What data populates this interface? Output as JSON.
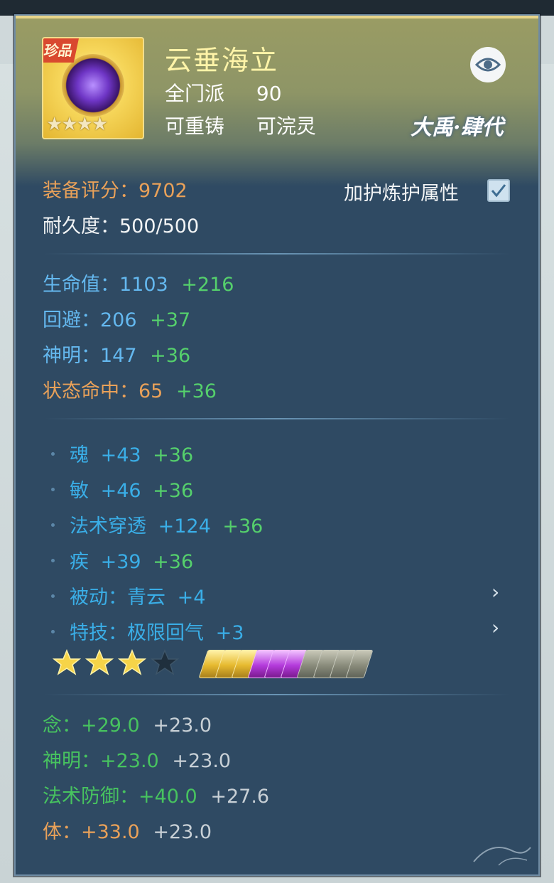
{
  "item": {
    "name": "云垂海立",
    "rarity_tag": "珍品",
    "icon_stars": "★★★★",
    "sect": "全门派",
    "level": "90",
    "reforgeable": "可重铸",
    "washable": "可浣灵",
    "brand": "大禹·肆代"
  },
  "score": {
    "label": "装备评分：",
    "value": "9702"
  },
  "durability": {
    "label": "耐久度：",
    "value": "500/500"
  },
  "protect_toggle": {
    "label": "加护炼护属性",
    "checked": true
  },
  "base_stats": [
    {
      "label": "生命值：",
      "value": "1103",
      "bonus": "+216"
    },
    {
      "label": "回避：",
      "value": "206",
      "bonus": "+37"
    },
    {
      "label": "神明：",
      "value": "147",
      "bonus": "+36"
    },
    {
      "label": "状态命中：",
      "value": "65",
      "bonus": "+36"
    }
  ],
  "extra_stats": [
    {
      "label": "魂",
      "value": "+43",
      "bonus": "+36"
    },
    {
      "label": "敏",
      "value": "+46",
      "bonus": "+36"
    },
    {
      "label": "法术穿透",
      "value": "+124",
      "bonus": "+36"
    },
    {
      "label": "疾",
      "value": "+39",
      "bonus": "+36"
    },
    {
      "label": "被动：青云",
      "value": "+4",
      "bonus": ""
    },
    {
      "label": "特技：极限回气",
      "value": "+3",
      "bonus": ""
    }
  ],
  "enhance": {
    "stars_filled": 3,
    "stars_total": 4,
    "gems": [
      "gold",
      "gold",
      "gold",
      "purple",
      "purple",
      "purple",
      "grey",
      "grey",
      "grey",
      "grey"
    ]
  },
  "refine_stats": [
    {
      "label": "念：",
      "value": "+29.0",
      "extra": "+23.0"
    },
    {
      "label": "神明：",
      "value": "+23.0",
      "extra": "+23.0"
    },
    {
      "label": "法术防御：",
      "value": "+40.0",
      "extra": "+27.6"
    },
    {
      "label": "体：",
      "value": "+33.0",
      "extra": "+23.0"
    }
  ],
  "icons": {
    "view": "eye-icon",
    "check": "checkmark-icon",
    "expand": "chevron-right-icon",
    "star": "star-icon"
  },
  "colors": {
    "panel_bg": "#2f4a63",
    "name": "#fff4a8",
    "score": "#e9a159",
    "base_stat": "#64b8ef",
    "bonus": "#55d06c",
    "refine": "#47c35f"
  }
}
